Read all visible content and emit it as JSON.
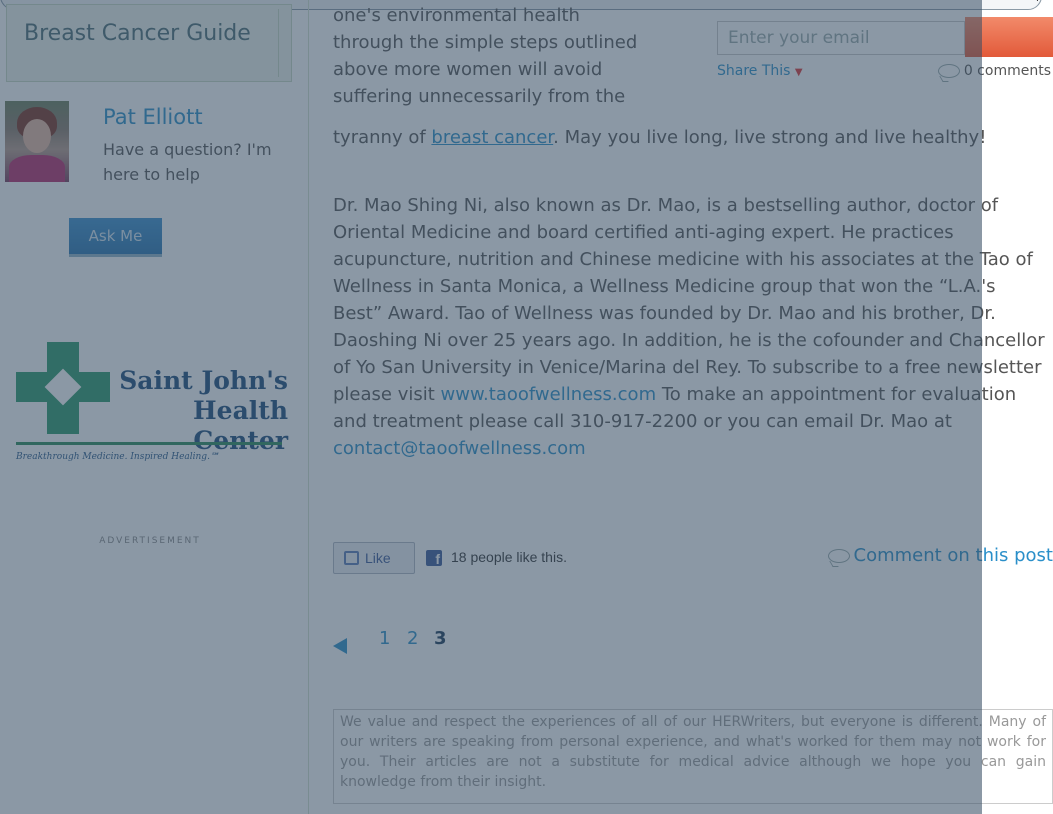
{
  "sidebar": {
    "guide_title": "Breast Cancer Guide",
    "author": {
      "name": "Pat Elliott",
      "subtitle": "Have a question? I'm here to help",
      "ask_label": "Ask Me"
    },
    "sponsor": {
      "name_line1": "Saint John's",
      "name_line2": "Health Center",
      "tagline": "Breakthrough Medicine. Inspired Healing.℠"
    },
    "ad_label": "ADVERTISEMENT"
  },
  "article": {
    "para_top_lines": [
      "one's environmental health",
      "through the simple steps outlined",
      "above more women will avoid",
      "suffering unnecessarily from the"
    ],
    "para_cont_pre": "tyranny of ",
    "para_cont_link": "breast cancer",
    "para_cont_post": ". May you live long, live strong and live healthy!",
    "bio_text": "Dr. Mao Shing Ni, also known as Dr. Mao, is a bestselling author, doctor of Oriental Medicine and board certified anti-aging expert. He practices acupuncture, nutrition and Chinese medicine with his associates at the Tao of Wellness in Santa Monica, a Wellness Medicine group that won the “L.A.'s Best” Award. Tao of Wellness was founded by Dr. Mao and his brother, Dr. Daoshing Ni over 25 years ago. In addition, he is the cofounder and Chancellor of Yo San University in Venice/Marina del Rey. To subscribe to a free newsletter please visit ",
    "bio_link1": "www.taoofwellness.com",
    "bio_mid": " To make an appointment for evaluation and treatment please call 310-917-2200 or you can email Dr. Mao at ",
    "bio_link2": "contact@taoofwellness.com"
  },
  "newsletter": {
    "email_placeholder": "Enter your email"
  },
  "share": {
    "share_label": "Share This",
    "comments_count": "0 comments"
  },
  "social": {
    "like_label": "Like",
    "like_count": "18 people like this.",
    "comment_link": "Comment on this post"
  },
  "pagination": {
    "pages": [
      "1",
      "2",
      "3"
    ],
    "current": "3"
  },
  "disclaimer": "We value and respect the experiences of all of our HERWriters, but everyone is different. Many of our writers are speaking from personal experience, and what's worked for them may not work for you. Their articles are not a substitute for medical advice although we hope you can gain knowledge from their insight.",
  "colors": {
    "link": "#2a8fc9",
    "overlay": "#374e64",
    "subscribe_button": "#e8643f",
    "sponsor_green": "#2a9a6a",
    "sponsor_navy": "#1c4a7a"
  }
}
